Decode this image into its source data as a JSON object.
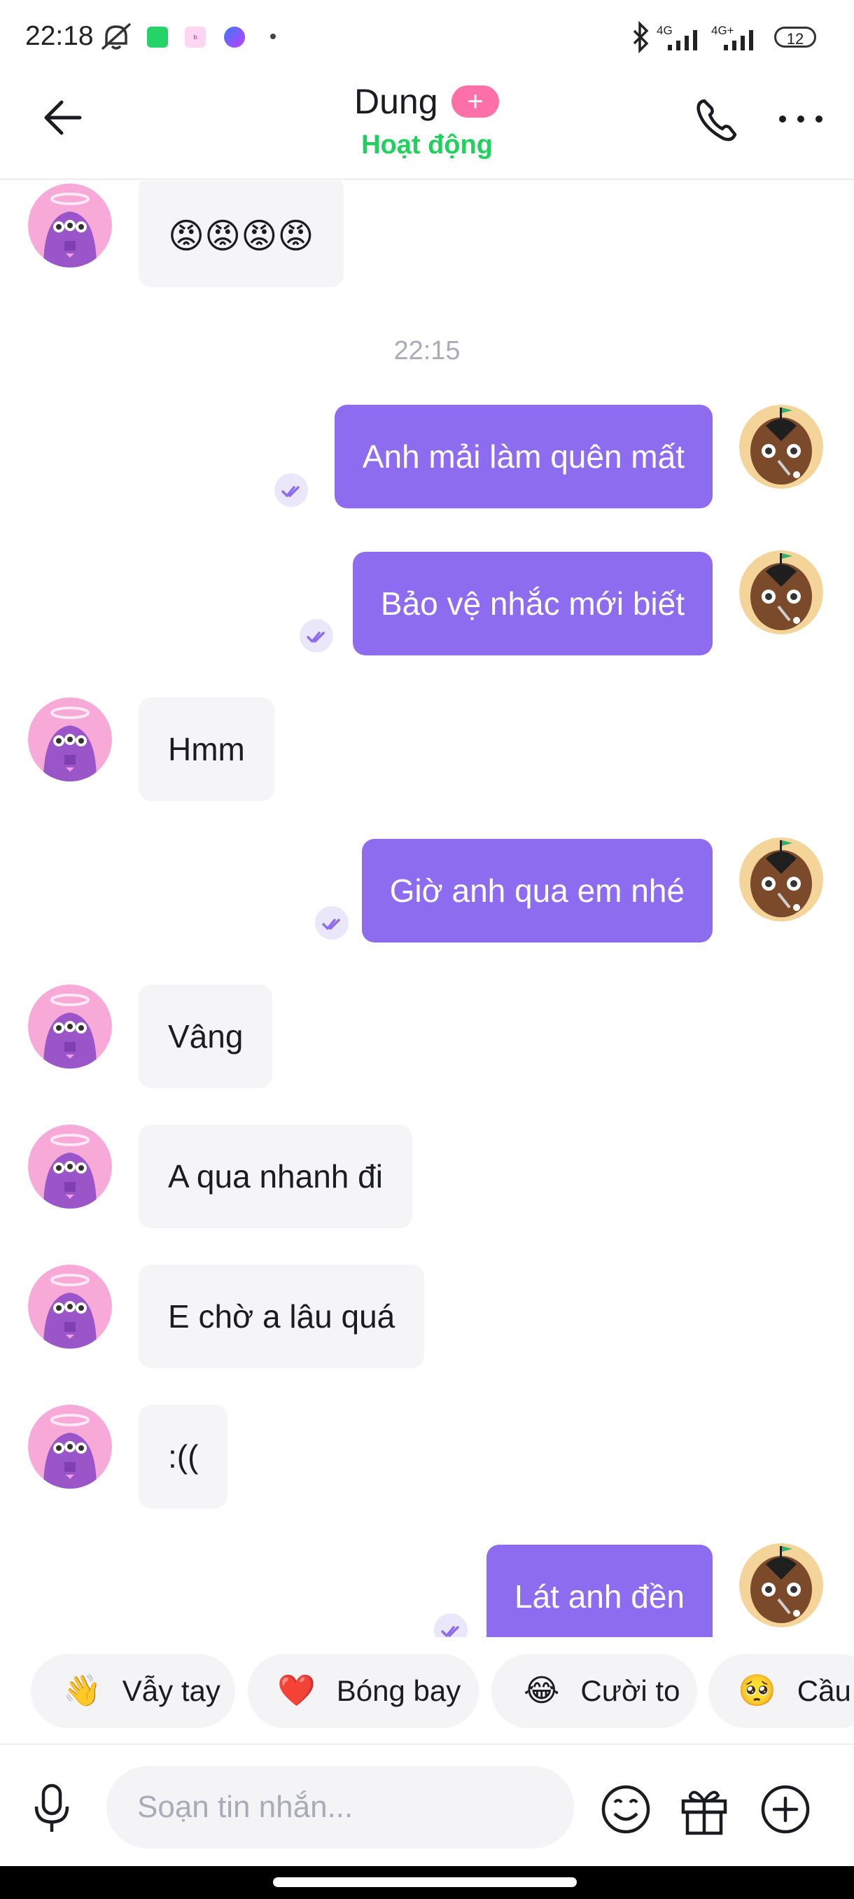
{
  "status_bar": {
    "time": "22:18",
    "network_1": "4G",
    "network_2": "4G+",
    "battery": "12",
    "icons": [
      "mute-bell-off-icon",
      "whatsapp-icon",
      "badoo-icon",
      "messenger-icon",
      "bluetooth-icon",
      "signal-icon",
      "battery-icon"
    ]
  },
  "header": {
    "contact_name": "Dung",
    "plus_badge": "+",
    "status": "Hoạt động",
    "icons": [
      "back-arrow-icon",
      "phone-icon",
      "more-icon"
    ]
  },
  "messages": [
    {
      "side": "in",
      "text": "😡😡😡😡"
    },
    {
      "side": "out",
      "text": "Anh mải làm quên mất"
    },
    {
      "side": "out",
      "text": "Bảo vệ nhắc mới biết"
    },
    {
      "side": "in",
      "text": "Hmm"
    },
    {
      "side": "out",
      "text": "Giờ anh qua em nhé"
    },
    {
      "side": "in",
      "text": "Vâng"
    },
    {
      "side": "in",
      "text": "A qua nhanh đi"
    },
    {
      "side": "in",
      "text": "E chờ a lâu quá"
    },
    {
      "side": "in",
      "text": ":(("
    },
    {
      "side": "out",
      "text": "Lát anh đền"
    }
  ],
  "timestamp": "22:15",
  "quick_replies": [
    {
      "emoji": "👋",
      "label": "Vẫy tay"
    },
    {
      "emoji": "❤️",
      "label": "Bóng bay"
    },
    {
      "emoji": "😂",
      "label": "Cười to"
    },
    {
      "emoji": "🥺",
      "label": "Cầu x"
    }
  ],
  "composer": {
    "placeholder": "Soạn tin nhắn...",
    "icons": [
      "microphone-icon",
      "emoji-icon",
      "gift-icon",
      "add-icon"
    ]
  },
  "colors": {
    "accent_purple": "#8e6cf0",
    "online_green": "#20d15d",
    "plus_pink": "#ff6fa8",
    "incoming_bubble": "#f5f5f7"
  }
}
